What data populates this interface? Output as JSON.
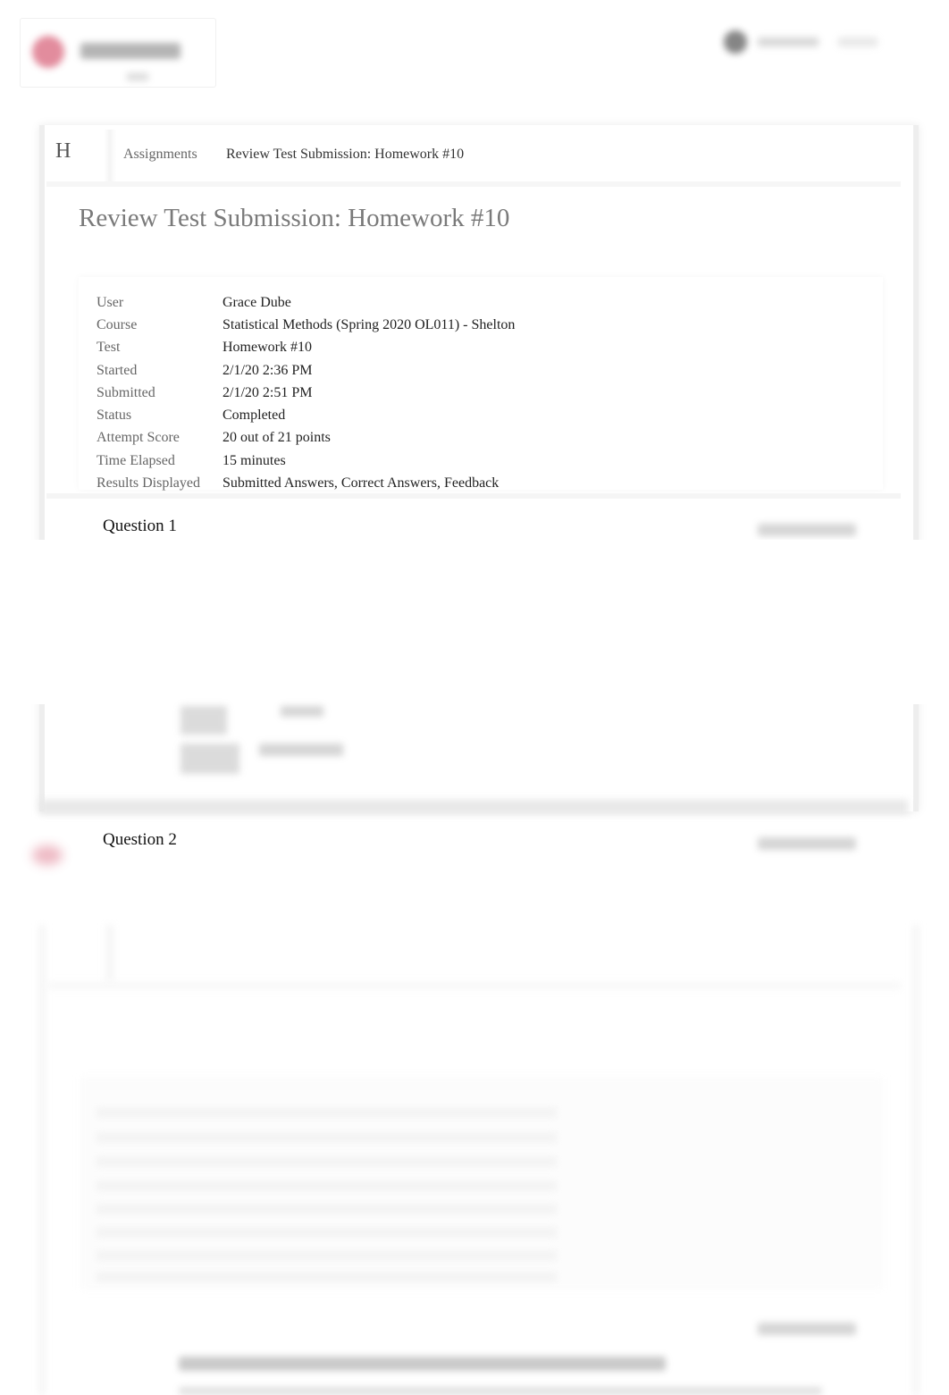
{
  "header": {
    "logo_icon": "school-crest-icon",
    "user_avatar_icon": "user-avatar-icon"
  },
  "breadcrumb": {
    "home_label": "H",
    "items": [
      {
        "label": "Assignments"
      },
      {
        "label": "Review Test Submission: Homework #10"
      }
    ]
  },
  "page": {
    "title": "Review Test Submission: Homework #10"
  },
  "submission_info": [
    {
      "label": "User",
      "value": "Grace Dube"
    },
    {
      "label": "Course",
      "value": "Statistical Methods (Spring 2020 OL011) - Shelton"
    },
    {
      "label": "Test",
      "value": "Homework #10"
    },
    {
      "label": "Started",
      "value": "2/1/20 2:36 PM"
    },
    {
      "label": "Submitted",
      "value": "2/1/20 2:51 PM"
    },
    {
      "label": "Status",
      "value": "Completed"
    },
    {
      "label": "Attempt Score",
      "value": "20 out of 21 points"
    },
    {
      "label": "Time Elapsed",
      "value": "15 minutes"
    },
    {
      "label": "Results Displayed",
      "value": "Submitted Answers, Correct Answers, Feedback"
    }
  ],
  "questions": [
    {
      "title": "Question 1"
    },
    {
      "title": "Question 2"
    }
  ]
}
